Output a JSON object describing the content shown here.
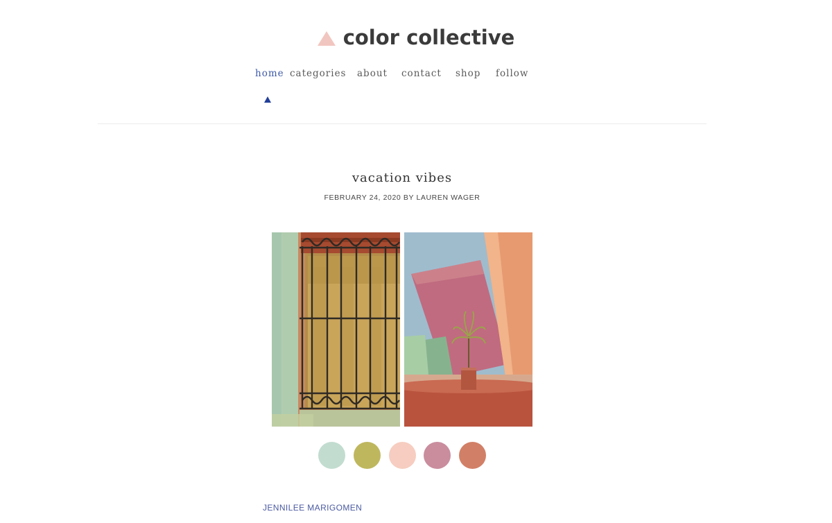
{
  "site": {
    "name": "color collective",
    "logo_icon": "triangle-icon",
    "logo_color": "#f2c6c0"
  },
  "nav": {
    "items": [
      {
        "label": "home",
        "active": true
      },
      {
        "label": "categories",
        "active": false
      },
      {
        "label": "about",
        "active": false
      },
      {
        "label": "contact",
        "active": false
      },
      {
        "label": "shop",
        "active": false
      },
      {
        "label": "follow",
        "active": false
      }
    ],
    "active_color": "#3f5aa8",
    "indicator_icon": "triangle-indicator-icon",
    "indicator_color": "#233f9a"
  },
  "post": {
    "title": "vacation vibes",
    "date": "FEBRUARY 24, 2020",
    "by": "BY",
    "author": "LAUREN WAGER",
    "photos": [
      {
        "subject": "window with iron grille",
        "name": "photo-window"
      },
      {
        "subject": "pink and orange architecture with potted palm",
        "name": "photo-architecture"
      }
    ],
    "palette": [
      "#c2dcd0",
      "#bfb75e",
      "#f6cdc0",
      "#c98d9e",
      "#d27f67"
    ],
    "credit": "JENNILEE MARIGOMEN"
  }
}
